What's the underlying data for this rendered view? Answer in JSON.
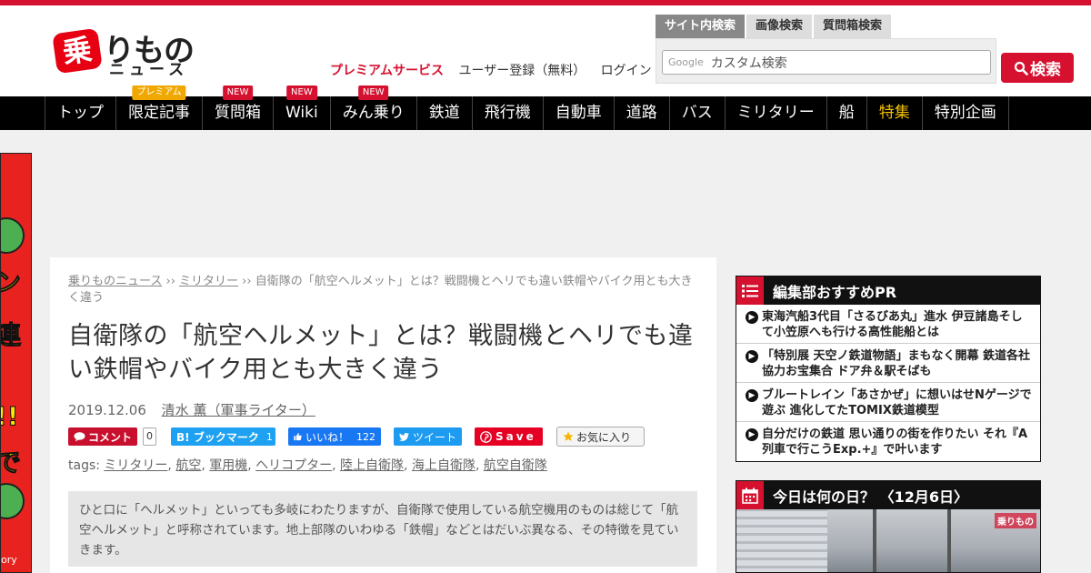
{
  "header": {
    "logo_badge": "乗",
    "logo_main": "りもの",
    "logo_sub": "ニュース",
    "premium_label": "プレミアムサービス",
    "register_label": "ユーザー登録（無料）",
    "login_label": "ログイン",
    "search_tabs": [
      {
        "label": "サイト内検索"
      },
      {
        "label": "画像検索"
      },
      {
        "label": "質問箱検索"
      }
    ],
    "search_google": "Google",
    "search_placeholder": "カスタム検索",
    "search_button": "検索"
  },
  "nav": {
    "items": [
      {
        "label": "トップ",
        "badge": ""
      },
      {
        "label": "限定記事",
        "badge": "プレミアム"
      },
      {
        "label": "質問箱",
        "badge": "NEW"
      },
      {
        "label": "Wiki",
        "badge": "NEW"
      },
      {
        "label": "みん乗り",
        "badge": "NEW"
      },
      {
        "label": "鉄道",
        "badge": ""
      },
      {
        "label": "飛行機",
        "badge": ""
      },
      {
        "label": "自動車",
        "badge": ""
      },
      {
        "label": "道路",
        "badge": ""
      },
      {
        "label": "バス",
        "badge": ""
      },
      {
        "label": "ミリタリー",
        "badge": ""
      },
      {
        "label": "船",
        "badge": ""
      },
      {
        "label": "特集",
        "badge": ""
      },
      {
        "label": "特別企画",
        "badge": ""
      }
    ]
  },
  "ad": {
    "text1": "ン",
    "text2": "連",
    "text3": "!!",
    "text4": "で",
    "small": "ory"
  },
  "article": {
    "breadcrumb": {
      "home": "乗りものニュース",
      "sep": " ›› ",
      "category": "ミリタリー",
      "current": "自衛隊の「航空ヘルメット」とは？戦闘機とヘリでも違い鉄帽やバイク用とも大きく違う"
    },
    "title": "自衛隊の「航空ヘルメット」とは？戦闘機とヘリでも違い鉄帽やバイク用とも大きく違う",
    "date": "2019.12.06",
    "author": "清水 薫（軍事ライター）",
    "share": {
      "comment_label": "コメント",
      "comment_count": "0",
      "hatena_label": "B! ブックマーク",
      "hatena_count": "1",
      "like_label": "いいね！",
      "like_count": "122",
      "tweet_label": "ツイート",
      "pin_label": "Save",
      "fav_label": "お気に入り"
    },
    "tags_label": "tags: ",
    "tags": [
      "ミリタリー",
      "航空",
      "軍用機",
      "ヘリコプター",
      "陸上自衛隊",
      "海上自衛隊",
      "航空自衛隊"
    ],
    "summary": "ひと口に「ヘルメット」といっても多岐にわたりますが、自衛隊で使用している航空機用のものは総じて「航空ヘルメット」と呼称されています。地上部隊のいわゆる「鉄帽」などとはだいぶ異なる、その特徴を見ていきます。"
  },
  "sidebar": {
    "pr_title": "編集部おすすめPR",
    "pr_items": [
      {
        "text": "東海汽船3代目「さるびあ丸」進水 伊豆諸島そして小笠原へも行ける高性能船とは"
      },
      {
        "text": "「特別展 天空ノ鉄道物語」まもなく開幕 鉄道各社協力お宝集合 ドア弁＆駅そばも"
      },
      {
        "text": "ブルートレイン「あさかぜ」に想いはせNゲージで遊ぶ 進化してたTOMIX鉄道模型"
      },
      {
        "text": "自分だけの鉄道 思い通りの街を作りたい それ『A列車で行こうExp.+』で叶います"
      }
    ],
    "today_title": "今日は何の日？ 〈12月6日〉",
    "today_watermark": "乗りもの"
  },
  "colors": {
    "brand": "#d6112f",
    "nav_bg": "#000000",
    "special": "#f0c000"
  }
}
